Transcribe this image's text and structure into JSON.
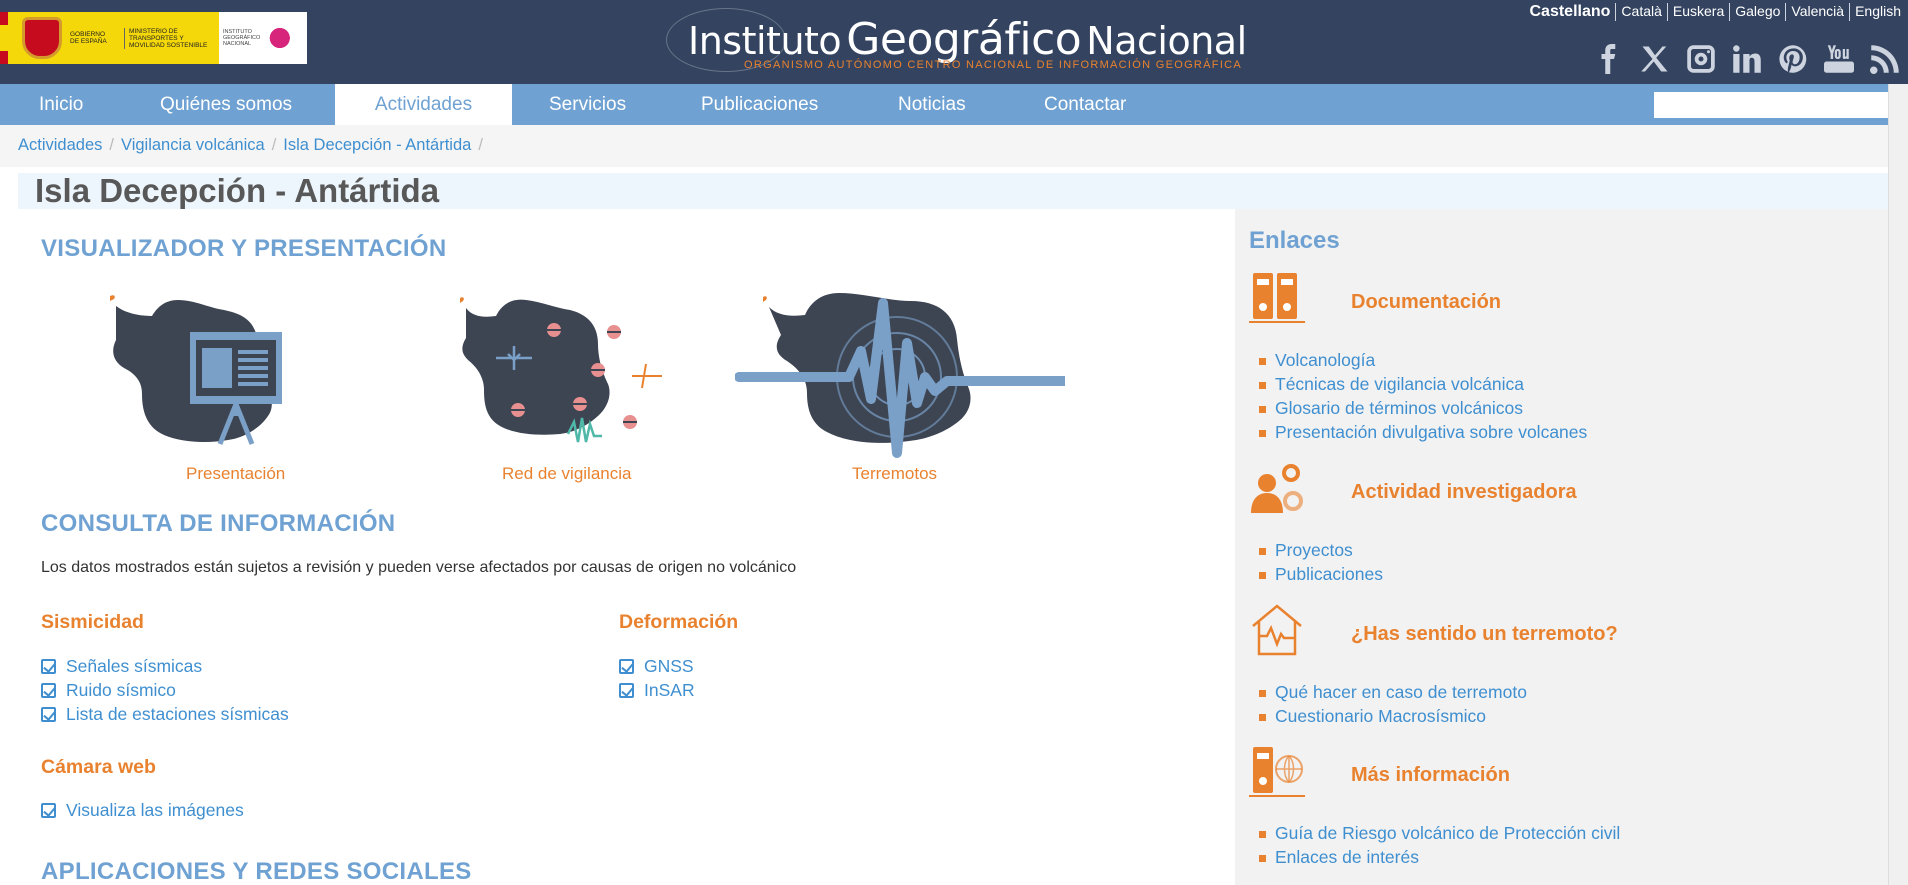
{
  "header": {
    "gov_text": "Gobierno de España",
    "ministry_text": "Ministerio de Transportes y Movilidad Sostenible",
    "ign_small_text": "Instituto Geográfico Nacional",
    "title_part1": "Instituto",
    "title_part2": "Geográfico",
    "title_part3": "Nacional",
    "subtitle": "Organismo Autónomo   Centro Nacional de Información Geográfica",
    "languages": [
      "Castellano",
      "Català",
      "Euskera",
      "Galego",
      "Valencià",
      "English"
    ],
    "socials": [
      "facebook-icon",
      "x-icon",
      "instagram-icon",
      "linkedin-icon",
      "pinterest-icon",
      "youtube-icon",
      "rss-icon"
    ]
  },
  "nav": {
    "items": [
      "Inicio",
      "Quiénes somos",
      "Actividades",
      "Servicios",
      "Publicaciones",
      "Noticias",
      "Contactar"
    ],
    "active": "Actividades",
    "search_placeholder": ""
  },
  "breadcrumb": [
    "Actividades",
    "Vigilancia volcánica",
    "Isla Decepción - Antártida"
  ],
  "page_title": "Isla Decepción - Antártida",
  "main": {
    "section1": "VISUALIZADOR Y PRESENTACIÓN",
    "cards": [
      "Presentación",
      "Red de vigilancia",
      "Terremotos"
    ],
    "section2": "CONSULTA DE INFORMACIÓN",
    "note": "Los datos mostrados están sujetos a revisión y pueden verse afectados por causas de origen no volcánico",
    "sismicidad": {
      "title": "Sismicidad",
      "items": [
        "Señales sísmicas",
        "Ruido sísmico",
        "Lista de estaciones sísmicas"
      ]
    },
    "deformacion": {
      "title": "Deformación",
      "items": [
        "GNSS",
        "InSAR"
      ]
    },
    "camara": {
      "title": "Cámara web",
      "items": [
        "Visualiza las imágenes"
      ]
    },
    "section3": "APLICACIONES Y REDES SOCIALES"
  },
  "sidebar": {
    "title": "Enlaces",
    "groups": [
      {
        "title": "Documentación",
        "icon": "binders-icon",
        "links": [
          "Volcanología",
          "Técnicas de vigilancia volcánica",
          "Glosario de términos volcánicos",
          "Presentación divulgativa sobre volcanes"
        ]
      },
      {
        "title": "Actividad investigadora",
        "icon": "researcher-gear-icon",
        "links": [
          "Proyectos",
          "Publicaciones"
        ]
      },
      {
        "title": "¿Has sentido un terremoto?",
        "icon": "house-seismic-icon",
        "links": [
          "Qué hacer en caso de terremoto",
          "Cuestionario Macrosísmico"
        ]
      },
      {
        "title": "Más información",
        "icon": "binder-globe-icon",
        "links": [
          "Guía de Riesgo volcánico de Protección civil",
          "Enlaces de interés"
        ]
      }
    ]
  },
  "colors": {
    "header_bg": "#344460",
    "nav_bg": "#6fa2d2",
    "accent_orange": "#e9822f",
    "link_blue": "#3f8fd0",
    "section_blue": "#6fa2d2",
    "map_dark": "#3d4452"
  }
}
